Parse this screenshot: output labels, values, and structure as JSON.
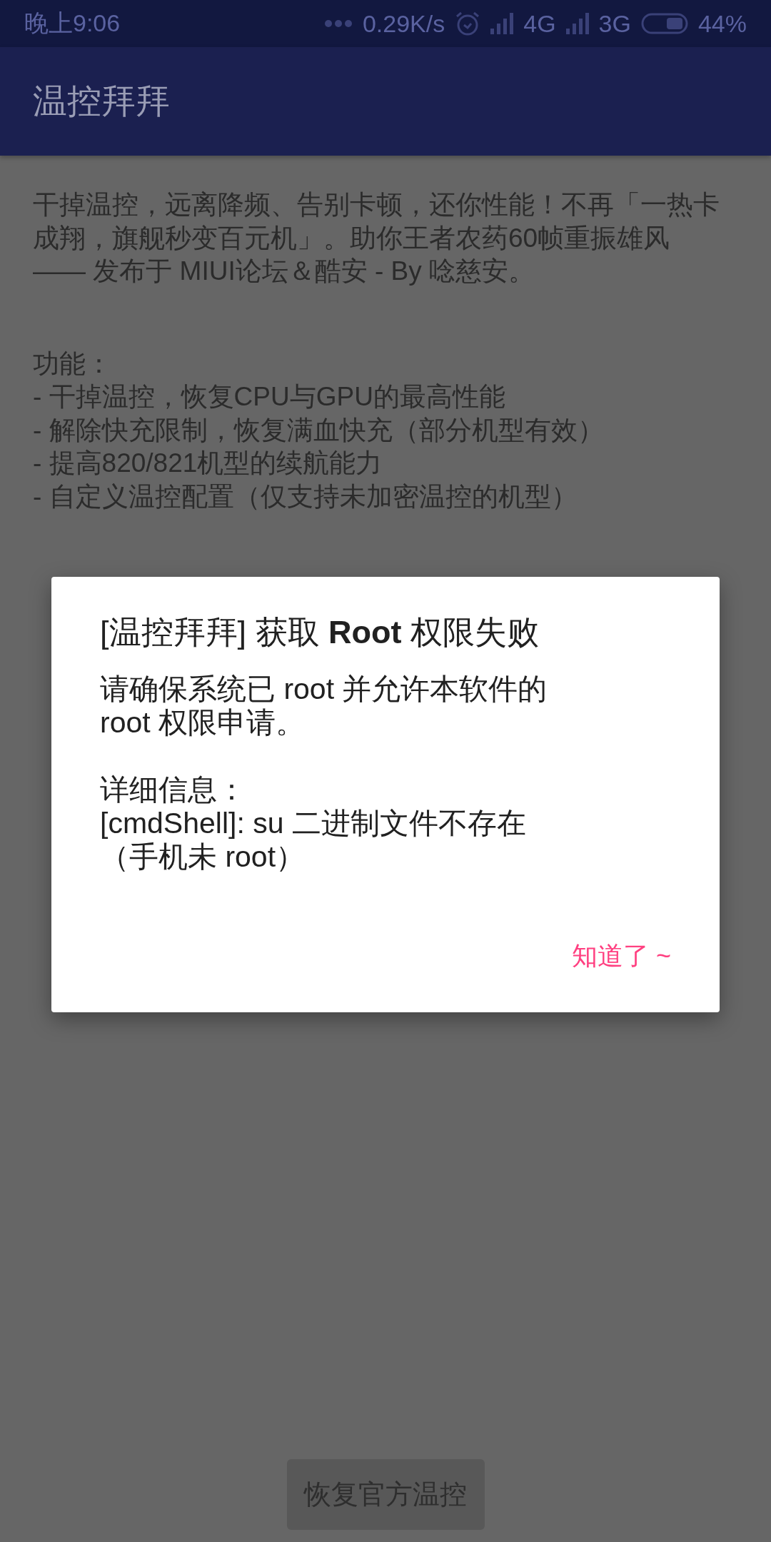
{
  "status_bar": {
    "time": "晚上9:06",
    "speed": "0.29K/s",
    "network_1": "4G",
    "network_2": "3G",
    "battery": "44%"
  },
  "app_bar": {
    "title": "温控拜拜"
  },
  "intro": {
    "lines": [
      "干掉温控，远离降频、告别卡顿，还你性能！不再「一热卡",
      "成翔，旗舰秒变百元机」。助你王者农药60帧重振雄风",
      "—— 发布于 MIUI论坛＆酷安 - By 唸慈安。"
    ]
  },
  "features": {
    "title": "功能：",
    "items": [
      "- 干掉温控，恢复CPU与GPU的最高性能",
      "- 解除快充限制，恢复满血快充（部分机型有效）",
      "- 提高820/821机型的续航能力",
      "- 自定义温控配置（仅支持未加密温控的机型）"
    ]
  },
  "bottom_button": {
    "label": "恢复官方温控",
    "disabled": true
  },
  "dialog": {
    "title": "[温控拜拜] 获取 **Root** 权限失败",
    "message": [
      "请确保系统已 root 并允许本软件的",
      "root 权限申请。"
    ],
    "details": [
      "详细信息：",
      "[cmdShell]: su 二进制文件不存在",
      "（手机未 root）"
    ],
    "button": "知道了 ~"
  }
}
